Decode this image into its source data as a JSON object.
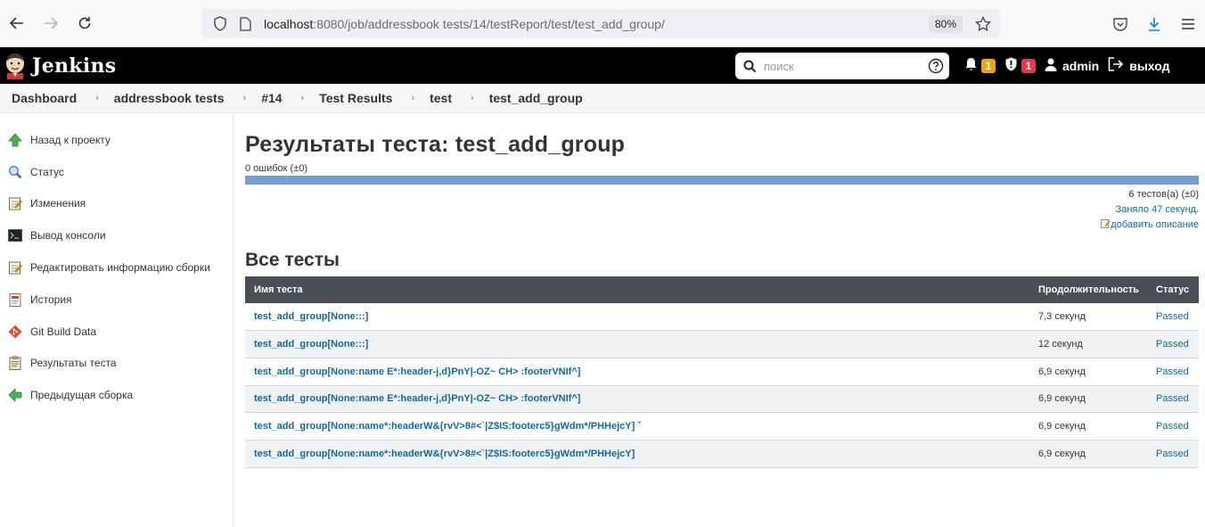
{
  "browser": {
    "url_host": "localhost",
    "url_rest": ":8080/job/addressbook tests/14/testReport/test/test_add_group/",
    "zoom": "80%"
  },
  "header": {
    "brand": "Jenkins",
    "search_placeholder": "поиск",
    "notifications_count": "1",
    "security_count": "1",
    "user": "admin",
    "logout": "выход"
  },
  "breadcrumbs": [
    "Dashboard",
    "addressbook tests",
    "#14",
    "Test Results",
    "test",
    "test_add_group"
  ],
  "sidebar": {
    "items": [
      {
        "label": "Назад к проекту",
        "icon": "up-arrow-icon"
      },
      {
        "label": "Статус",
        "icon": "magnifier-icon"
      },
      {
        "label": "Изменения",
        "icon": "notepad-icon"
      },
      {
        "label": "Вывод консоли",
        "icon": "terminal-icon"
      },
      {
        "label": "Редактировать информацию сборки",
        "icon": "notepad-edit-icon"
      },
      {
        "label": "История",
        "icon": "history-icon"
      },
      {
        "label": "Git Build Data",
        "icon": "git-icon"
      },
      {
        "label": "Результаты теста",
        "icon": "clipboard-icon"
      },
      {
        "label": "Предыдущая сборка",
        "icon": "left-arrow-icon"
      }
    ]
  },
  "main": {
    "title": "Результаты теста: test_add_group",
    "failures": "0 ошибок (±0)",
    "pass_fraction": 1.0,
    "tests_count": "6 тестов(а) (±0)",
    "duration": "Заняло 47 секунд.",
    "add_description": "добавить описание",
    "section_title": "Все тесты",
    "table": {
      "headers": {
        "name": "Имя теста",
        "duration": "Продолжительность",
        "status": "Статус"
      },
      "rows": [
        {
          "name": "test_add_group[None:::]",
          "duration": "7,3 секунд",
          "status": "Passed"
        },
        {
          "name": "test_add_group[None:::]",
          "duration": "12 секунд",
          "status": "Passed"
        },
        {
          "name": "test_add_group[None:name E*:header-j,d}PnY|-OZ~ CH> :footerVNIf^]",
          "duration": "6,9 секунд",
          "status": "Passed"
        },
        {
          "name": "test_add_group[None:name E*:header-j,d}PnY|-OZ~ CH> :footerVNIf^]",
          "duration": "6,9 секунд",
          "status": "Passed"
        },
        {
          "name": "test_add_group[None:name*:headerW&{rvV>8#<`|Z$IS:footerc5}gWdm*/PHHejcY] ˇ",
          "duration": "6,9 секунд",
          "status": "Passed"
        },
        {
          "name": "test_add_group[None:name*:headerW&{rvV>8#<`|Z$IS:footerc5}gWdm*/PHHejcY]",
          "duration": "6,9 секунд",
          "status": "Passed"
        }
      ]
    }
  }
}
